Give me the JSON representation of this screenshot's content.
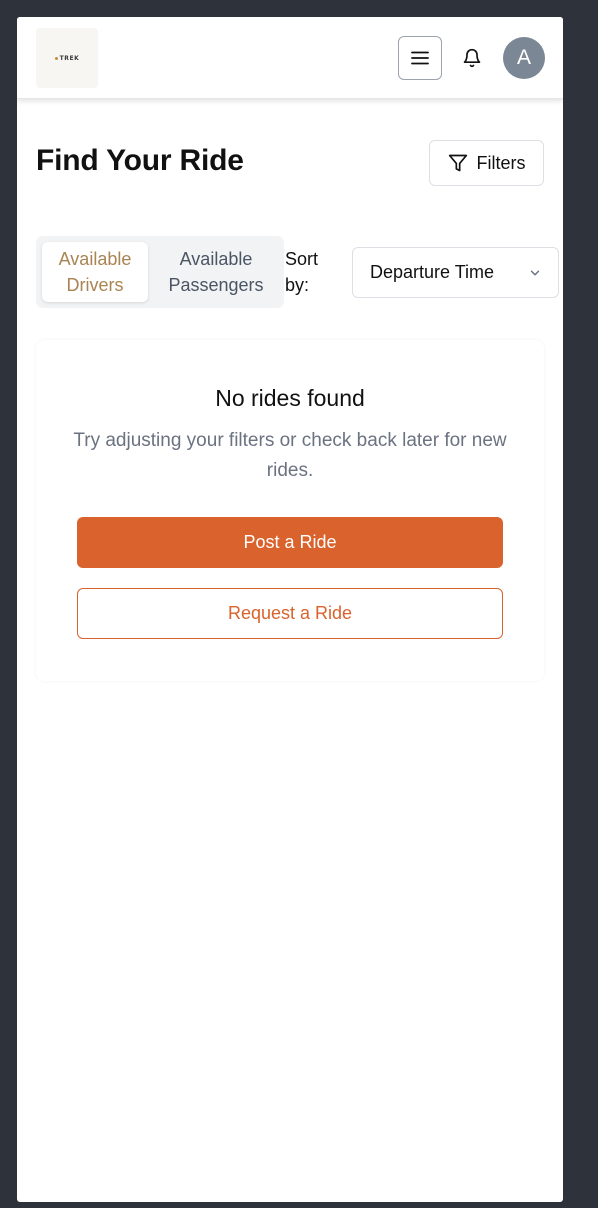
{
  "header": {
    "logo_text": "TREK",
    "menu_icon": "hamburger-menu-icon",
    "notification_icon": "bell-icon",
    "avatar_initial": "A"
  },
  "page": {
    "title": "Find Your Ride",
    "filters_label": "Filters",
    "filters_icon": "filter-funnel-icon"
  },
  "tabs": [
    {
      "label": "Available Drivers",
      "active": true
    },
    {
      "label": "Available Passengers",
      "active": false
    }
  ],
  "sort": {
    "label": "Sort by:",
    "selected": "Departure Time",
    "icon": "chevron-down-icon"
  },
  "empty_state": {
    "title": "No rides found",
    "message": "Try adjusting your filters or check back later for new rides.",
    "primary_action": "Post a Ride",
    "secondary_action": "Request a Ride"
  },
  "colors": {
    "accent": "#da622c",
    "active_tab_text": "#a98452",
    "backdrop": "#2e323b",
    "avatar_bg": "#7b8794"
  }
}
